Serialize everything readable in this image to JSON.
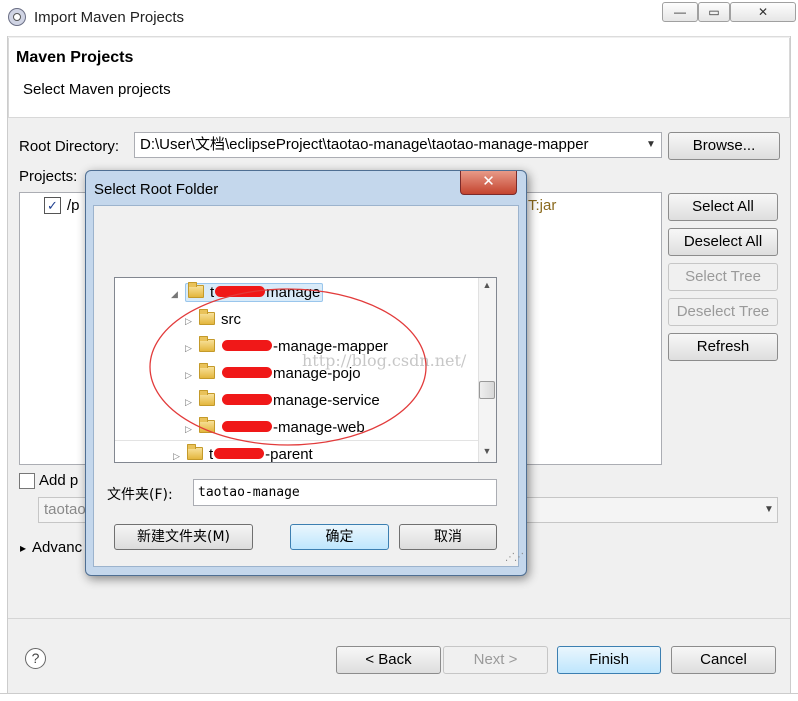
{
  "window": {
    "title": "Import Maven Projects",
    "minimize": "—",
    "maximize": "▭",
    "close": "✕"
  },
  "header": {
    "title": "Maven Projects",
    "subtitle": "Select Maven projects"
  },
  "root": {
    "label": "Root Directory:",
    "value": "D:\\User\\文档\\eclipseProject\\taotao-manage\\taotao-manage-mapper",
    "browse": "Browse..."
  },
  "projects": {
    "label": "Projects:",
    "item_prefix": "/p",
    "item_suffix": "T:jar",
    "checked_mark": "✓"
  },
  "side_buttons": {
    "select_all": "Select All",
    "deselect_all": "Deselect All",
    "select_tree": "Select Tree",
    "deselect_tree": "Deselect Tree",
    "refresh": "Refresh"
  },
  "options": {
    "add_label": "Add p",
    "working_value": "taotao",
    "advanced": "Advanc",
    "advanced_arrow": "▸"
  },
  "footer": {
    "help": "?",
    "back": "< Back",
    "next": "Next >",
    "finish": "Finish",
    "cancel": "Cancel"
  },
  "dialog": {
    "title": "Select Root Folder",
    "close": "✕",
    "tree": [
      {
        "prefix": "t",
        "suffix": "manage",
        "expanded": true
      },
      {
        "prefix": "",
        "suffix": "src"
      },
      {
        "prefix": "",
        "suffix": "-manage-mapper"
      },
      {
        "prefix": "",
        "suffix": "manage-pojo"
      },
      {
        "prefix": "",
        "suffix": "manage-service"
      },
      {
        "prefix": "",
        "suffix": "-manage-web"
      },
      {
        "prefix": "t",
        "suffix": "-parent"
      }
    ],
    "watermark": "http://blog.csdn.net/",
    "folder_label": "文件夹(F):",
    "folder_value": "taotao-manage",
    "new_folder": "新建文件夹(M)",
    "ok": "确定",
    "cancel": "取消"
  },
  "colors": {
    "annotation": "#e23b3b",
    "redaction": "#f01818",
    "selection": "#d9ebf9"
  }
}
